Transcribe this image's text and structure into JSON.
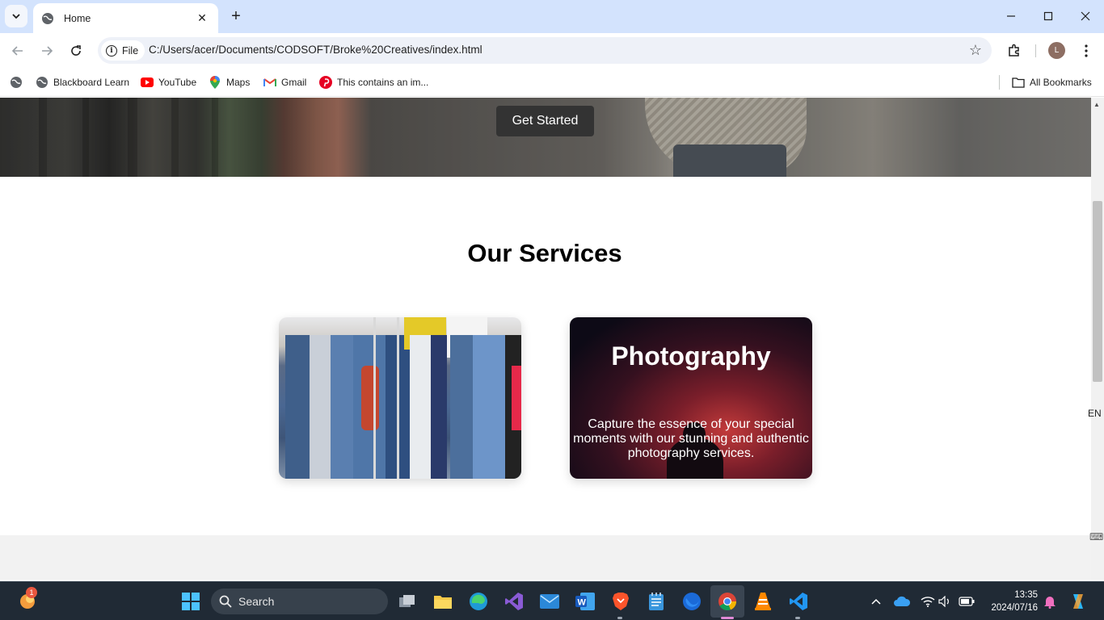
{
  "browser": {
    "tab_title": "Home",
    "new_tab_symbol": "+",
    "close_tab_symbol": "✕",
    "url_scheme_label": "File",
    "url": "C:/Users/acer/Documents/CODSOFT/Broke%20Creatives/index.html",
    "profile_initial": "L"
  },
  "bookmarks": {
    "items": [
      {
        "label": "Blackboard Learn",
        "icon": "globe-icon"
      },
      {
        "label": "YouTube",
        "icon": "youtube-icon"
      },
      {
        "label": "Maps",
        "icon": "maps-pin-icon"
      },
      {
        "label": "Gmail",
        "icon": "gmail-icon"
      },
      {
        "label": "This contains an im...",
        "icon": "pinterest-icon"
      }
    ],
    "all_bookmarks_label": "All Bookmarks"
  },
  "page": {
    "hero_button_label": "Get Started",
    "services_heading": "Our Services",
    "cards": [
      {
        "image": "clothing-rack-photo"
      },
      {
        "title": "Photography",
        "description": "Capture the essence of your special moments with our stunning and authentic photography services."
      }
    ]
  },
  "system_side": {
    "language": "EN"
  },
  "taskbar": {
    "search_label": "Search",
    "time": "13:35",
    "date": "2024/07/16",
    "notification_count": "1"
  },
  "colors": {
    "tab_strip": "#d3e3fd",
    "cta_button": "#333333",
    "taskbar": "#202a35"
  }
}
